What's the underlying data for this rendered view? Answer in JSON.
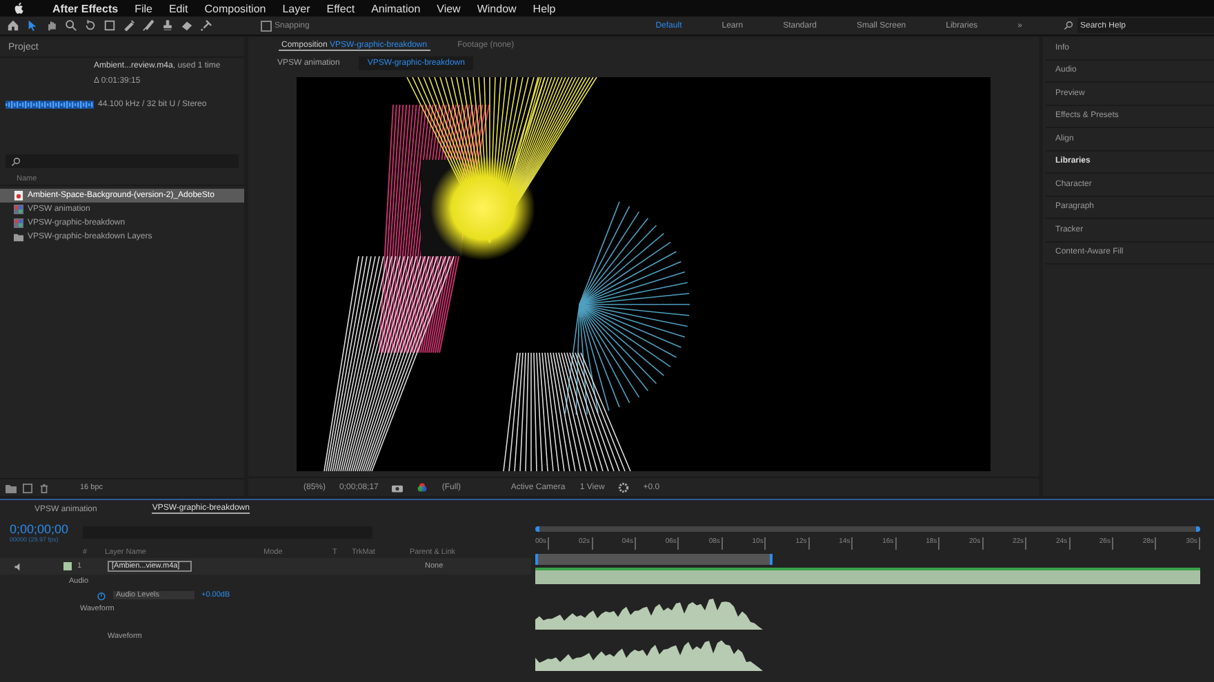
{
  "menu_bar": {
    "app": "After Effects",
    "items": [
      "File",
      "Edit",
      "Composition",
      "Layer",
      "Effect",
      "Animation",
      "View",
      "Window",
      "Help"
    ]
  },
  "toolbar": {
    "snapping": {
      "label": "Snapping",
      "checked": false
    },
    "workspaces": [
      {
        "label": "Default",
        "selected": true
      },
      {
        "label": "Learn",
        "selected": false
      },
      {
        "label": "Standard",
        "selected": false
      },
      {
        "label": "Small Screen",
        "selected": false
      },
      {
        "label": "Libraries",
        "selected": false
      }
    ],
    "more": "»",
    "search_placeholder": "Search Help"
  },
  "project": {
    "title": "Project",
    "footage_name": "Ambient...review.m4a",
    "usage": ", used 1 time",
    "duration": "Δ 0:01:39:15",
    "audio_info": "44.100 kHz / 32 bit U / Stereo",
    "name_column": "Name",
    "bpc": "16 bpc",
    "items": [
      {
        "name": "Ambient-Space-Background-(version-2)_AdobeSto",
        "kind": "audio",
        "selected": true
      },
      {
        "name": "VPSW animation",
        "kind": "comp",
        "selected": false
      },
      {
        "name": "VPSW-graphic-breakdown",
        "kind": "comp",
        "selected": false
      },
      {
        "name": "VPSW-graphic-breakdown Layers",
        "kind": "folder",
        "selected": false
      }
    ]
  },
  "composition": {
    "panel_title": "Composition",
    "comp_name": "VPSW-graphic-breakdown",
    "footage_tab": "Footage (none)",
    "breadcrumbs": [
      {
        "label": "VPSW animation",
        "selected": false
      },
      {
        "label": "VPSW-graphic-breakdown",
        "selected": true
      }
    ],
    "viewer_bar": {
      "zoom": "(85%)",
      "timecode": "0;00;08;17",
      "resolution": "(Full)",
      "camera": "Active Camera",
      "views": "1 View",
      "exposure": "+0.0"
    }
  },
  "right_panel": [
    {
      "label": "Info",
      "selected": false
    },
    {
      "label": "Audio",
      "selected": false
    },
    {
      "label": "Preview",
      "selected": false
    },
    {
      "label": "Effects & Presets",
      "selected": false
    },
    {
      "label": "Align",
      "selected": false
    },
    {
      "label": "Libraries",
      "selected": true
    },
    {
      "label": "Character",
      "selected": false
    },
    {
      "label": "Paragraph",
      "selected": false
    },
    {
      "label": "Tracker",
      "selected": false
    },
    {
      "label": "Content-Aware Fill",
      "selected": false
    }
  ],
  "timeline": {
    "tabs": [
      {
        "label": "VPSW animation",
        "selected": false
      },
      {
        "label": "VPSW-graphic-breakdown",
        "selected": true
      }
    ],
    "timecode": "0;00;00;00",
    "fps": "00000 (29.97 fps)",
    "columns": {
      "number": "#",
      "layer_name": "Layer Name",
      "mode": "Mode",
      "t": "T",
      "trkmat": "TrkMat",
      "parent": "Parent & Link"
    },
    "layer": {
      "number": "1",
      "name": "[Ambien...view.m4a]",
      "parent": "None"
    },
    "audio_group": "Audio",
    "property": {
      "name": "Audio Levels",
      "value": "+0.00dB"
    },
    "waveform_group": "Waveform",
    "waveform_label": "Waveform",
    "ruler": [
      "00s",
      "02s",
      "04s",
      "06s",
      "08s",
      "10s",
      "12s",
      "14s",
      "16s",
      "18s",
      "20s",
      "22s",
      "24s",
      "26s",
      "28s",
      "30s"
    ]
  }
}
